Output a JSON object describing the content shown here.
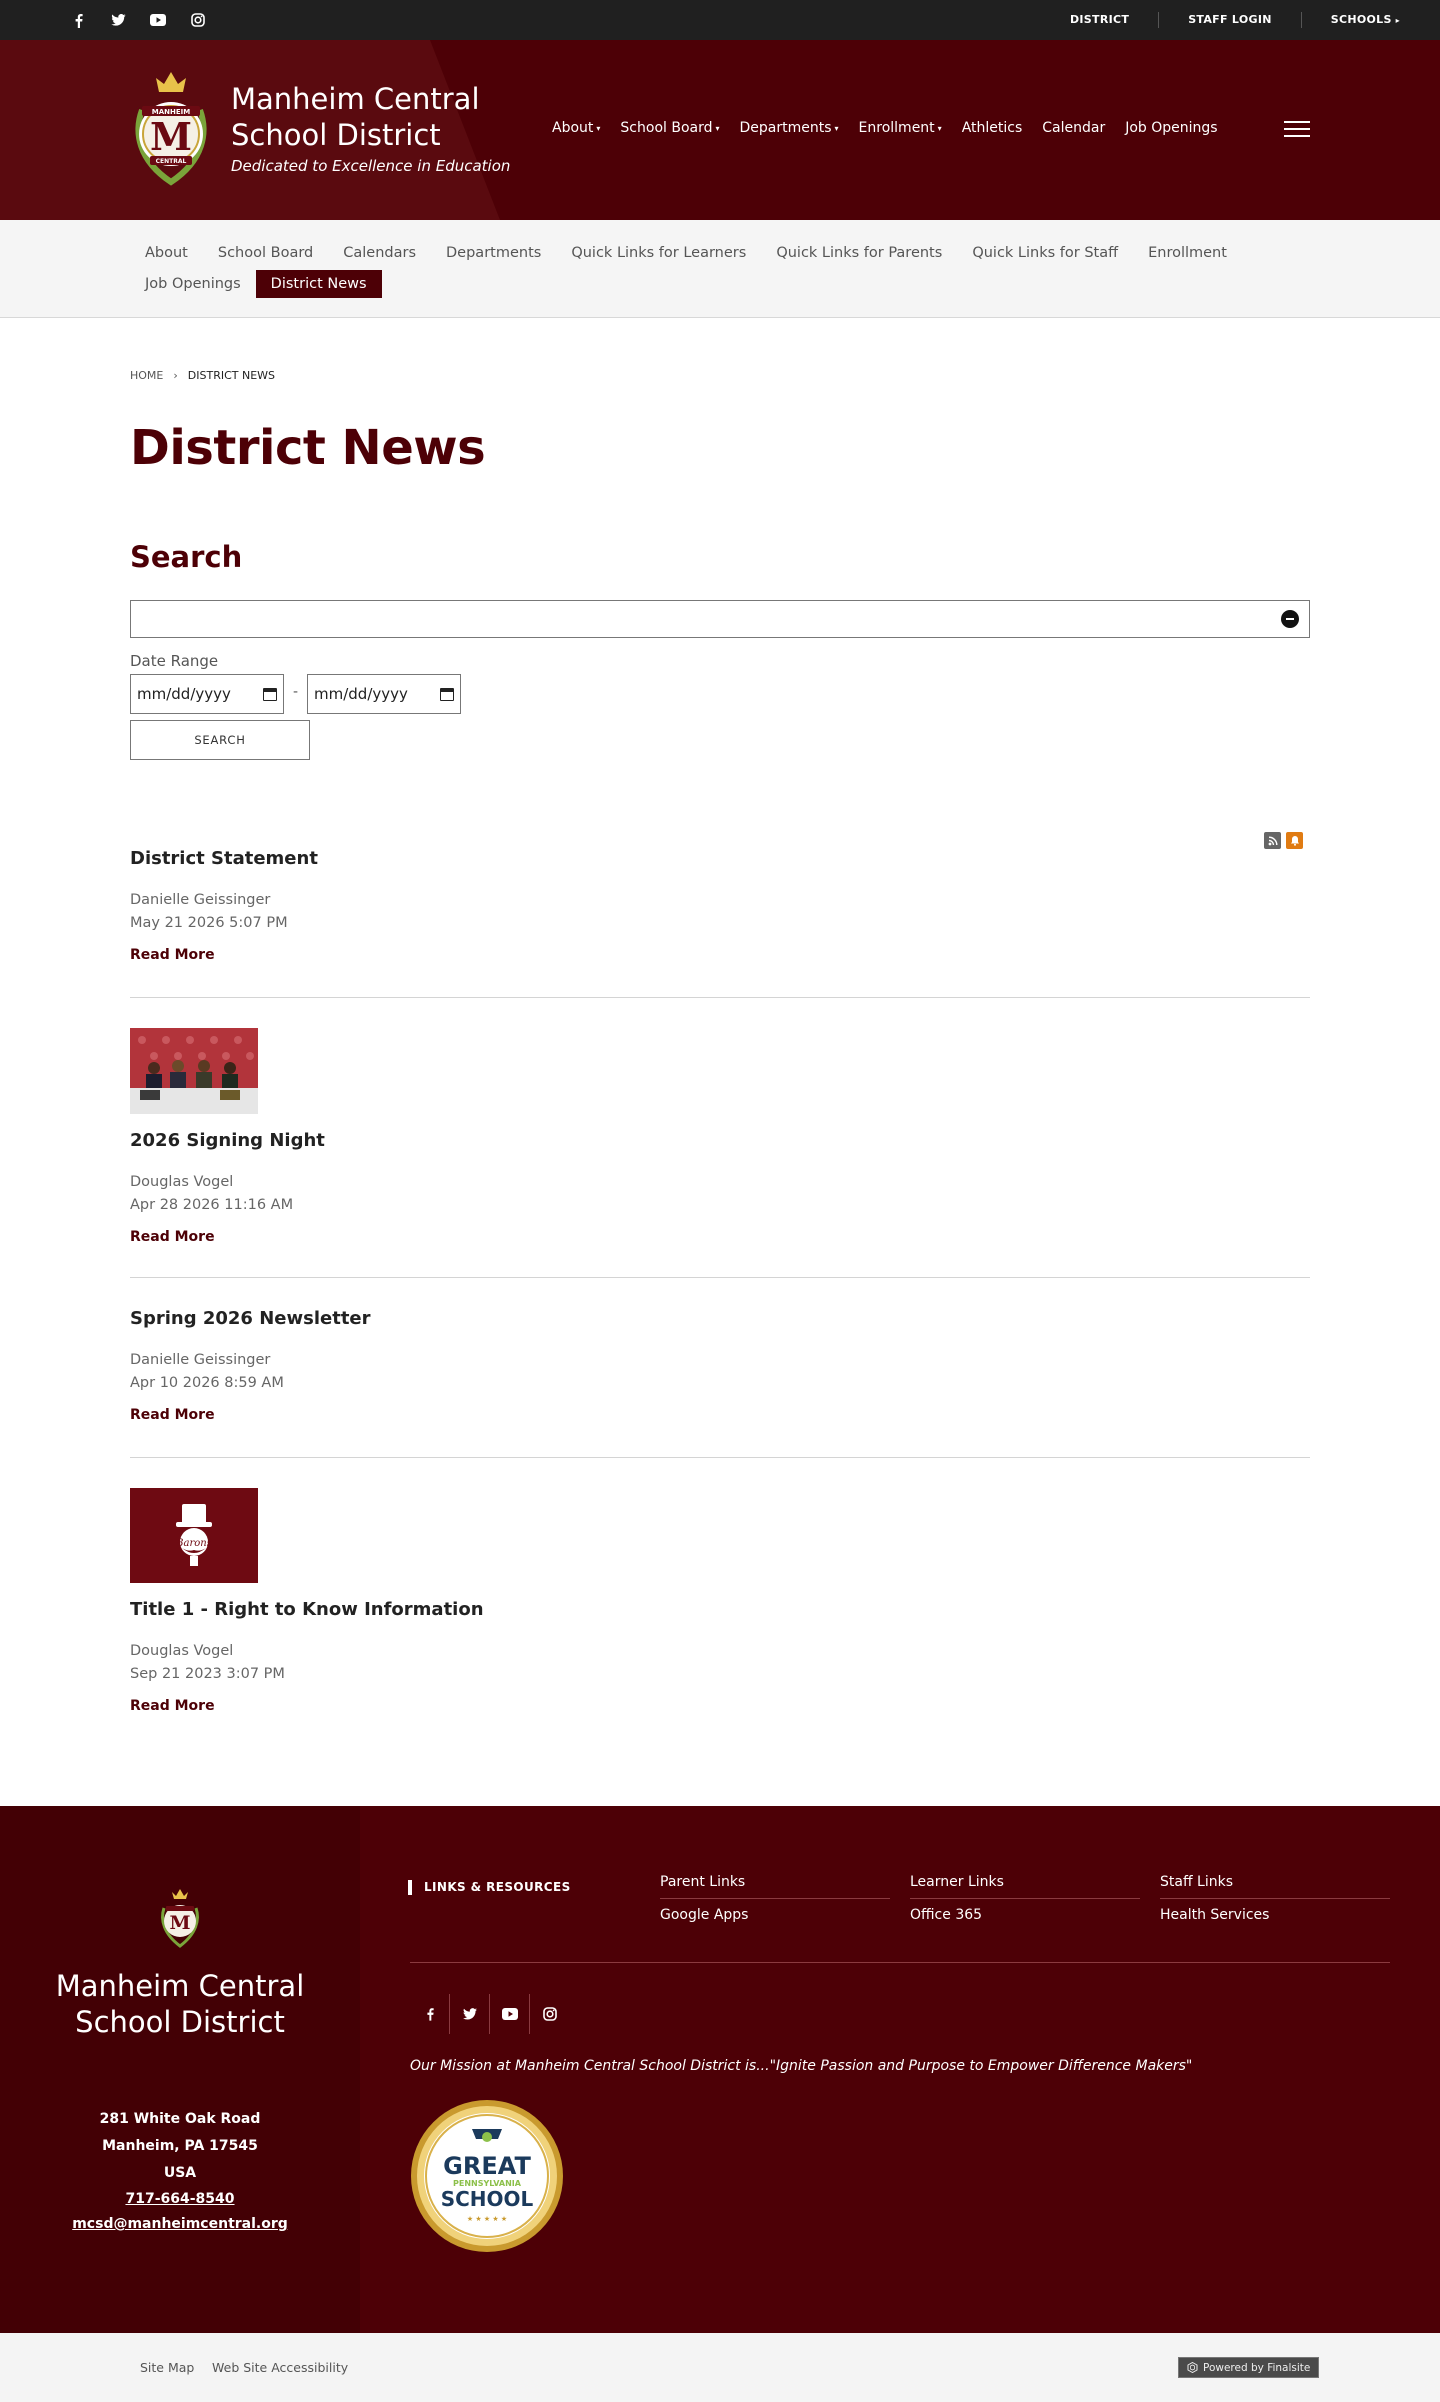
{
  "topbar": {
    "social_icons": [
      "facebook-icon",
      "twitter-icon",
      "youtube-icon",
      "instagram-icon"
    ],
    "links": [
      "DISTRICT",
      "STAFF LOGIN",
      "SCHOOLS"
    ]
  },
  "header": {
    "site_name_line1": "Manheim Central",
    "site_name_line2": "School District",
    "tagline": "Dedicated to Excellence in Education",
    "crest_text_top": "MANHEIM",
    "crest_text_bottom": "CENTRAL",
    "nav": [
      {
        "label": "About",
        "has_dropdown": true
      },
      {
        "label": "School Board",
        "has_dropdown": true
      },
      {
        "label": "Departments",
        "has_dropdown": true
      },
      {
        "label": "Enrollment",
        "has_dropdown": true
      },
      {
        "label": "Athletics",
        "has_dropdown": false
      },
      {
        "label": "Calendar",
        "has_dropdown": false
      },
      {
        "label": "Job Openings",
        "has_dropdown": false
      }
    ]
  },
  "subnav": {
    "row1": [
      "About",
      "School Board",
      "Calendars",
      "Departments",
      "Quick Links for Learners",
      "Quick Links for Parents",
      "Quick Links for Staff",
      "Enrollment"
    ],
    "row2": [
      "Job Openings",
      "District News"
    ],
    "active": "District News"
  },
  "breadcrumb": {
    "home": "HOME",
    "current": "DISTRICT NEWS"
  },
  "page_title": "District News",
  "search": {
    "heading": "Search",
    "value": "",
    "date_range_label": "Date Range",
    "date_from_placeholder": "mm/dd/yyyy",
    "date_to_placeholder": "mm/dd/yyyy",
    "date_separator": "-",
    "button_label": "SEARCH"
  },
  "posts": [
    {
      "title": "District Statement",
      "author": "Danielle Geissinger",
      "date": "May 21 2026 5:07 PM",
      "read_more": "Read More",
      "thumbnail": null
    },
    {
      "title": "2026 Signing Night",
      "author": "Douglas Vogel",
      "date": "Apr 28 2026 11:16 AM",
      "read_more": "Read More",
      "thumbnail": "signing-night-photo"
    },
    {
      "title": "Spring 2026 Newsletter",
      "author": "Danielle Geissinger",
      "date": "Apr 10 2026 8:59 AM",
      "read_more": "Read More",
      "thumbnail": null
    },
    {
      "title": "Title 1 - Right to Know Information",
      "author": "Douglas Vogel",
      "date": "Sep 21 2023 3:07 PM",
      "read_more": "Read More",
      "thumbnail": "barons-logo"
    }
  ],
  "footer": {
    "name_line1": "Manheim Central",
    "name_line2": "School District",
    "address_line1": "281 White Oak Road",
    "address_line2": "Manheim, PA  17545",
    "address_line3": "USA",
    "phone": "717-664-8540",
    "email": "mcsd@manheimcentral.org",
    "links_heading": "LINKS & RESOURCES",
    "links": [
      "Parent Links",
      "Learner Links",
      "Staff Links",
      "Google Apps",
      "Office 365",
      "Health Services"
    ],
    "mission": "Our Mission at Manheim Central School District is...\"Ignite Passion and Purpose to Empower Difference Makers\"",
    "badge_line1": "GREAT",
    "badge_line2": "PENNSYLVANIA",
    "badge_line3": "SCHOOL"
  },
  "bottombar": {
    "site_map": "Site Map",
    "accessibility": "Web Site Accessibility",
    "powered_by": "Powered by Finalsite"
  },
  "colors": {
    "brand": "#4d0006",
    "topbar": "#202020",
    "subnav_bg": "#f5f5f5"
  }
}
